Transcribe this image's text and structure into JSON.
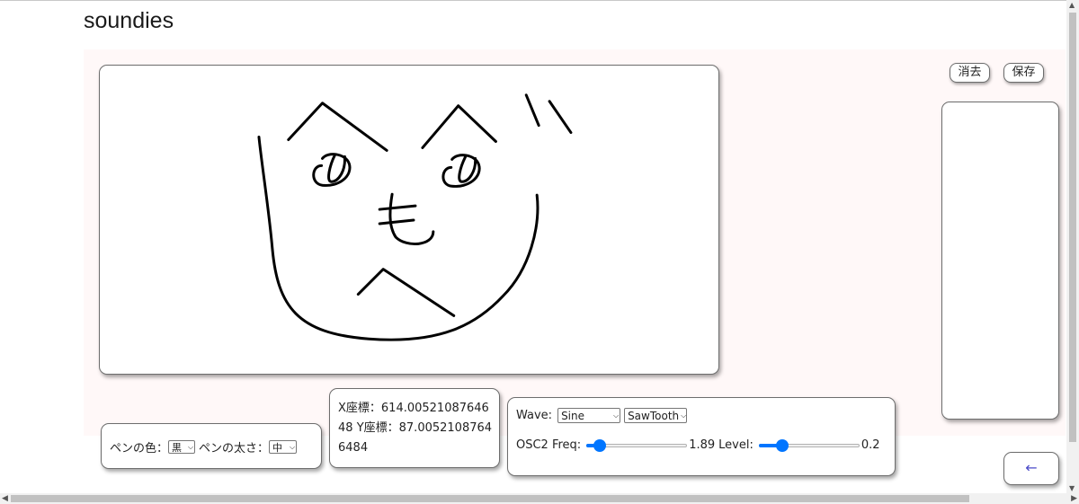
{
  "app": {
    "title": "soundies"
  },
  "toolbar": {
    "clear_label": "消去",
    "save_label": "保存"
  },
  "pen": {
    "color_label": "ペンの色：",
    "color_value": "黒",
    "width_label": "ペンの太さ：",
    "width_value": "中"
  },
  "coords": {
    "x_label": "X座標：",
    "x_value": "614.0052108764648",
    "y_label": "Y座標：",
    "y_value": "87.00521087646484"
  },
  "wave": {
    "label": "Wave:",
    "osc1_type": "Sine",
    "osc2_type": "SawTooth",
    "osc2_freq_label": "OSC2 Freq:",
    "osc2_freq_value": "1.89",
    "osc2_freq_fraction": 0.08,
    "level_label": "Level:",
    "level_value": "0.2",
    "level_fraction": 0.2
  },
  "nav": {
    "back_label": "←"
  },
  "colors": {
    "slider_accent": "#0075ff",
    "back_arrow": "#4a4ac8",
    "work_bg": "#fff8f8"
  },
  "icons": {
    "dropdown": "chevron-down-icon",
    "back": "arrow-left-icon"
  }
}
